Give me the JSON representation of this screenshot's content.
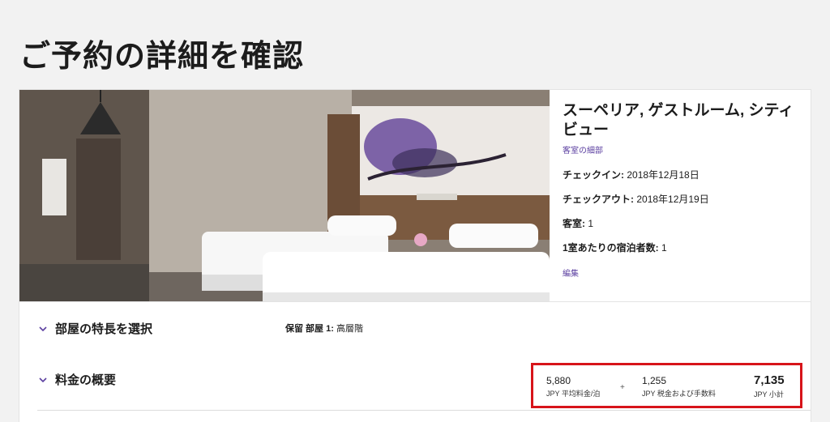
{
  "page": {
    "title": "ご予約の詳細を確認"
  },
  "room": {
    "name": "スーペリア, ゲストルーム, シティビュー",
    "details_link": "客室の細部",
    "checkin_label": "チェックイン:",
    "checkin_value": "2018年12月18日",
    "checkout_label": "チェックアウト:",
    "checkout_value": "2018年12月19日",
    "rooms_label": "客室:",
    "rooms_value": "1",
    "guests_label": "1室あたりの宿泊者数:",
    "guests_value": "1",
    "edit_link": "編集"
  },
  "features": {
    "title": "部屋の特長を選択",
    "note_label": "保留 部屋 1:",
    "note_value": "高層階"
  },
  "rates": {
    "title": "料金の概要",
    "avg_value": "5,880",
    "avg_label": "JPY 平均料金/泊",
    "plus": "+",
    "tax_value": "1,255",
    "tax_label": "JPY 税金および手数料",
    "subtotal_value": "7,135",
    "subtotal_label": "JPY 小計"
  },
  "colors": {
    "link": "#5b3fa0",
    "highlight_border": "#d7141a",
    "page_bg": "#f2f2f2"
  }
}
